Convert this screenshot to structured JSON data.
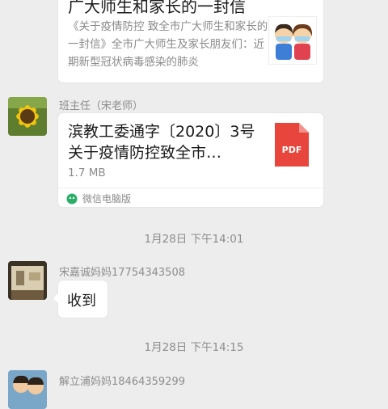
{
  "article": {
    "title": "广大师生和家长的一封信",
    "description": "《关于疫情防控 致全市广大师生和家长的一封信》全市广大师生及家长朋友们：近期新型冠状病毒感染的肺炎"
  },
  "messages": [
    {
      "sender": "班主任（宋老师）",
      "file_name": "滨教工委通字〔2020〕3号关于疫情防控致全市…",
      "file_size": "1.7 MB",
      "file_type": "PDF",
      "source": "微信电脑版"
    },
    {
      "timestamp": "1月28日 下午14:01",
      "sender": "宋嘉诚妈妈17754343508",
      "text": "收到"
    },
    {
      "timestamp": "1月28日 下午14:15",
      "sender": "解立浦妈妈18464359299"
    }
  ],
  "colors": {
    "background": "#ededed",
    "bubble": "#ffffff",
    "pdf_red": "#e8453c",
    "meta_gray": "#8d8d8d"
  },
  "icons": {
    "pdf": "pdf-file-icon",
    "pc": "wechat-pc-icon"
  }
}
